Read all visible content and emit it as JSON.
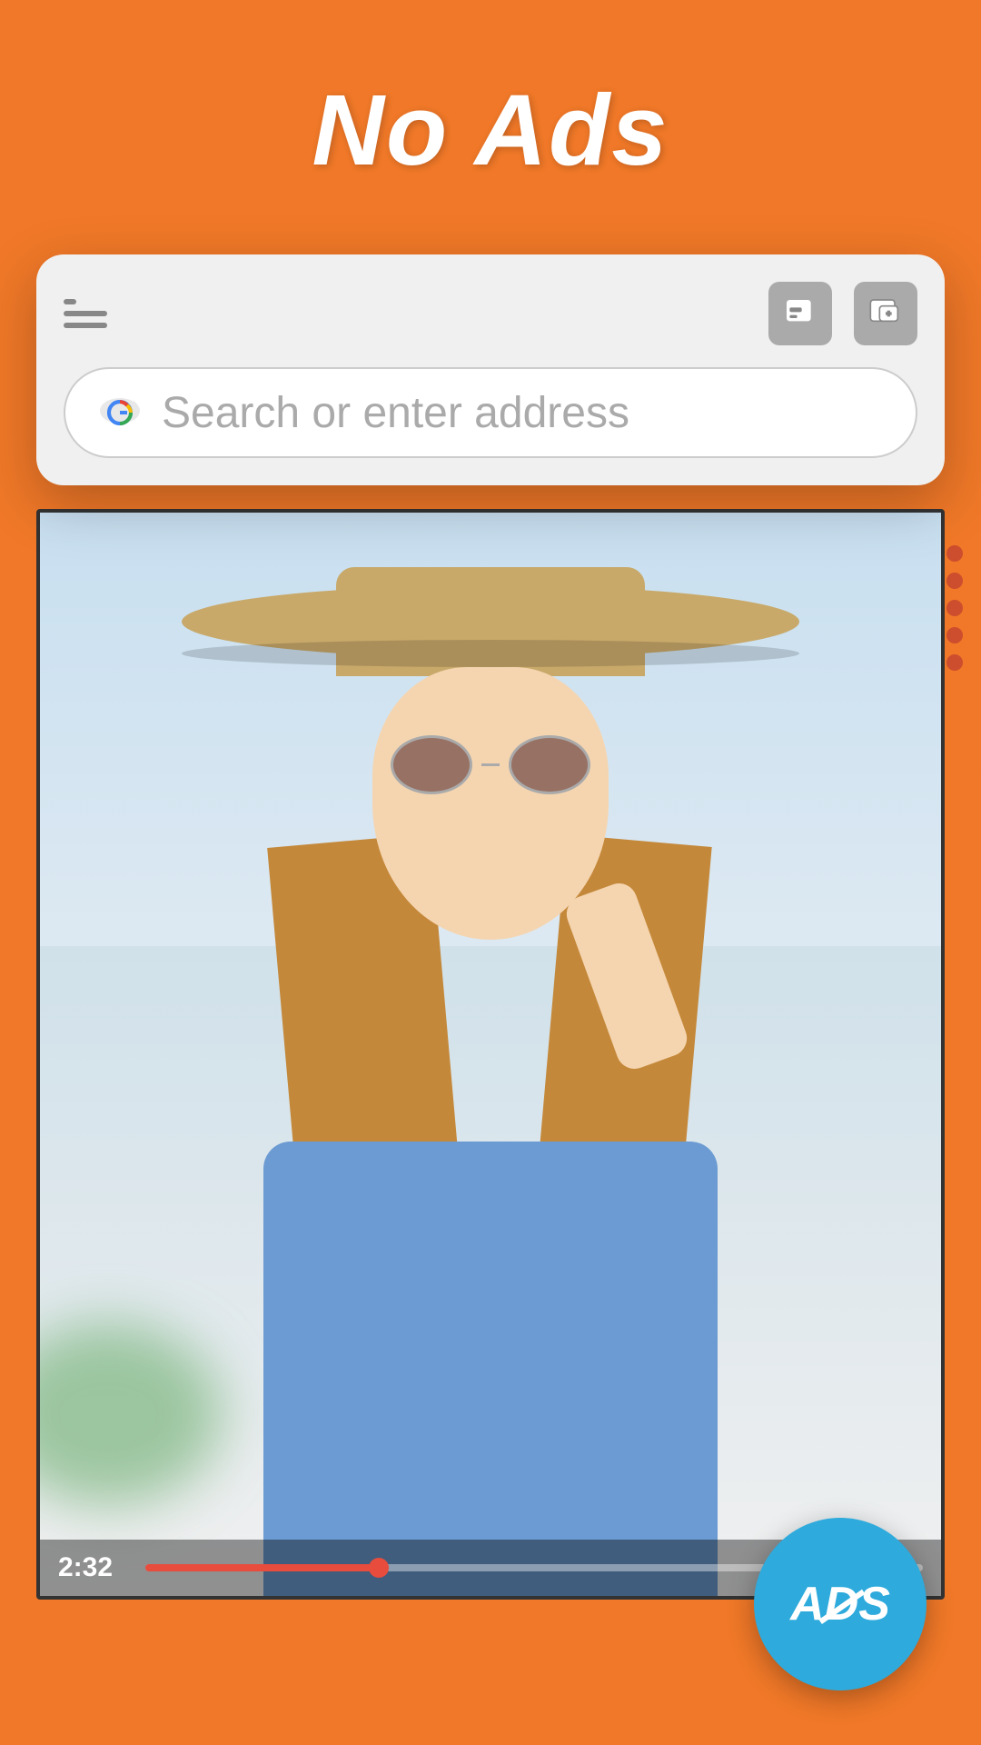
{
  "page": {
    "title": "No Ads",
    "background_color": "#F07828"
  },
  "header": {
    "title": "No Ads"
  },
  "browser": {
    "search_placeholder": "Search or enter address",
    "toolbar": {
      "menu_label": "Menu",
      "private_tab_label": "Private Tab",
      "new_tab_label": "New Tab"
    }
  },
  "video": {
    "timestamp": "2:32",
    "progress_percent": 30
  },
  "badge": {
    "text": "ADS",
    "label": "No Ads Badge"
  }
}
